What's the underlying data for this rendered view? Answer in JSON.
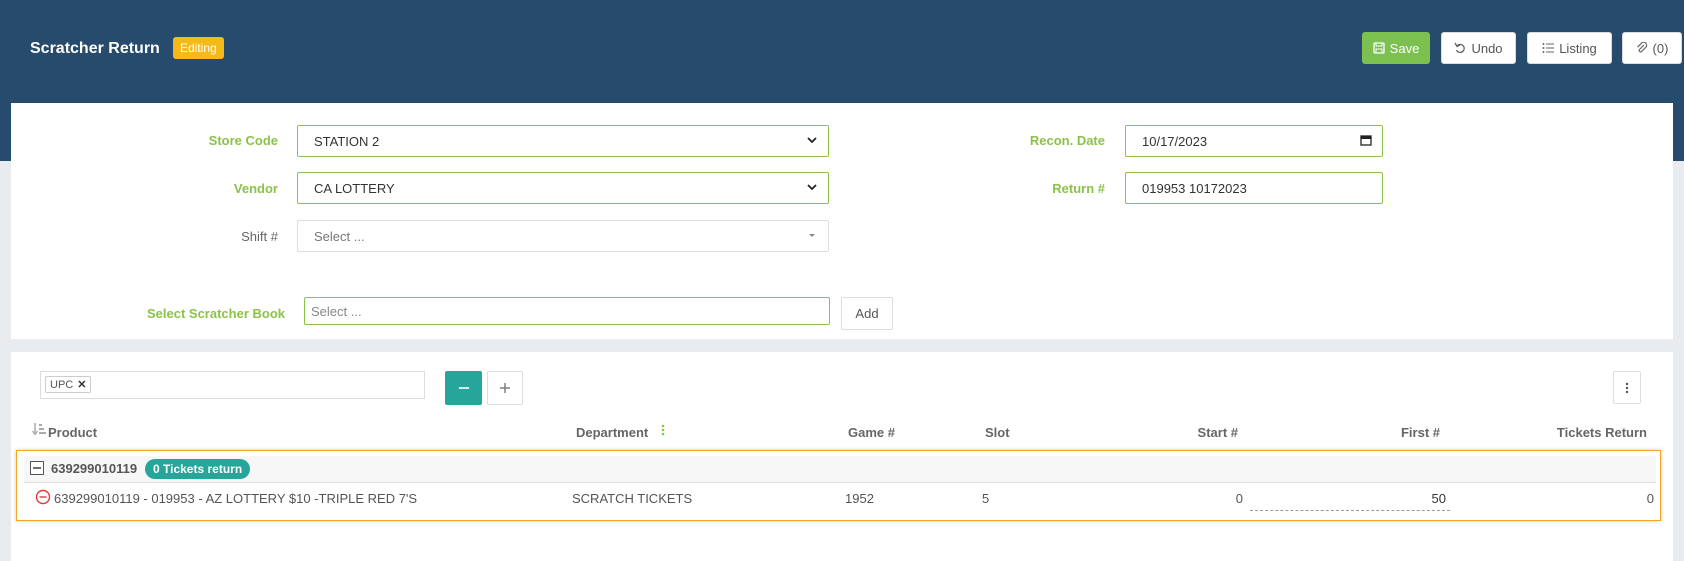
{
  "header": {
    "title": "Scratcher Return",
    "status_badge": "Editing",
    "buttons": {
      "save": "Save",
      "undo": "Undo",
      "listing": "Listing",
      "attachments": "(0)"
    }
  },
  "form": {
    "store_code": {
      "label": "Store Code",
      "value": "STATION 2"
    },
    "vendor": {
      "label": "Vendor",
      "value": "CA LOTTERY"
    },
    "shift": {
      "label": "Shift #",
      "placeholder": "Select ..."
    },
    "recon_date": {
      "label": "Recon. Date",
      "value": "10/17/2023"
    },
    "return_no": {
      "label": "Return #",
      "value": "019953 10172023"
    },
    "scratcher_book": {
      "label": "Select Scratcher Book",
      "placeholder": "Select ...",
      "add_button": "Add"
    }
  },
  "grid": {
    "group_by_tag": "UPC",
    "columns": [
      "Product",
      "Department",
      "Game #",
      "Slot",
      "Start #",
      "First #",
      "Tickets Return"
    ],
    "group": {
      "key": "639299010119",
      "badge": "0 Tickets return"
    },
    "rows": [
      {
        "product": "639299010119 - 019953 - AZ LOTTERY $10 -TRIPLE RED 7'S",
        "department": "SCRATCH TICKETS",
        "game": "1952",
        "slot": "5",
        "start": "0",
        "first": "50",
        "tickets_return": "0"
      }
    ]
  },
  "colors": {
    "header_bg": "#274b6d",
    "accent_green": "#8bc34a",
    "save_green": "#7cc14f",
    "badge_yellow": "#f5b918",
    "teal": "#26a69a",
    "highlight_orange": "#f5a623"
  }
}
